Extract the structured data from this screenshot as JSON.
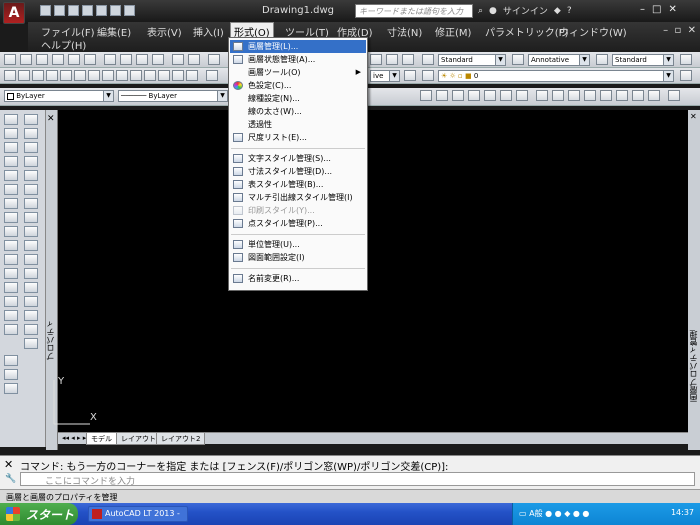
{
  "title_bar": {
    "app_logo": "A",
    "doc_title": "Drawing1.dwg",
    "search_placeholder": "キーワードまたは語句を入力",
    "sign_in": "サインイン",
    "help": "?",
    "win_min": "–",
    "win_max": "□",
    "win_close": "✕"
  },
  "menu": {
    "items": [
      "ファイル(F)",
      "編集(E)",
      "表示(V)",
      "挿入(I)",
      "形式(O)",
      "ツール(T)",
      "作成(D)",
      "寸法(N)",
      "修正(M)",
      "パラメトリック(P)",
      "ウィンドウ(W)",
      "ヘルプ(H)"
    ],
    "active_index": 4
  },
  "toolbars": {
    "text_style": "Standard",
    "dim_style": "Annotative",
    "table_style": "Standard",
    "layer_value": "0",
    "color": "ByLayer",
    "linetype": "ByLayer",
    "lineweight_frag": "ive"
  },
  "format_menu": {
    "items": [
      {
        "label": "画層管理(L)...",
        "icon": "layer-icon",
        "state": "highlighted"
      },
      {
        "label": "画層状態管理(A)...",
        "icon": "layer-state-icon",
        "state": "normal"
      },
      {
        "label": "画層ツール(O)",
        "icon": "",
        "state": "submenu"
      },
      {
        "label": "色設定(C)...",
        "icon": "color-wheel-icon",
        "state": "normal"
      },
      {
        "label": "線種設定(N)...",
        "icon": "",
        "state": "normal"
      },
      {
        "label": "線の太さ(W)...",
        "icon": "",
        "state": "normal"
      },
      {
        "label": "透過性",
        "icon": "",
        "state": "normal"
      },
      {
        "label": "尺度リスト(E)...",
        "icon": "scale-icon",
        "state": "normal"
      },
      {
        "label": "文字スタイル管理(S)...",
        "icon": "text-style-icon",
        "state": "normal"
      },
      {
        "label": "寸法スタイル管理(D)...",
        "icon": "dim-style-icon",
        "state": "normal"
      },
      {
        "label": "表スタイル管理(B)...",
        "icon": "table-style-icon",
        "state": "normal"
      },
      {
        "label": "マルチ引出線スタイル管理(I)",
        "icon": "mleader-icon",
        "state": "normal"
      },
      {
        "label": "印刷スタイル(Y)...",
        "icon": "print-style-icon",
        "state": "disabled"
      },
      {
        "label": "点スタイル管理(P)...",
        "icon": "point-style-icon",
        "state": "normal"
      },
      {
        "label": "単位管理(U)...",
        "icon": "units-icon",
        "state": "normal"
      },
      {
        "label": "図面範囲設定(I)",
        "icon": "limits-icon",
        "state": "normal"
      },
      {
        "label": "名前変更(R)...",
        "icon": "rename-icon",
        "state": "normal"
      }
    ]
  },
  "palette": {
    "left_title": "プロパティ",
    "right_title": "画層プロパティ管理"
  },
  "layout_tabs": [
    "モデル",
    "レイアウト1",
    "レイアウト2"
  ],
  "command": {
    "history": "コマンド: もう一方のコーナーを指定 または [フェンス(F)/ポリゴン窓(WP)/ポリゴン交差(CP)]:",
    "input_placeholder": "ここにコマンドを入力"
  },
  "status_bar": {
    "text": "画層と画層のプロパティを管理"
  },
  "ucs": {
    "x_label": "X",
    "y_label": "Y"
  },
  "taskbar": {
    "start": "スタート",
    "task": "AutoCAD LT 2013 -",
    "ime": "A般",
    "clock": "14:37"
  }
}
